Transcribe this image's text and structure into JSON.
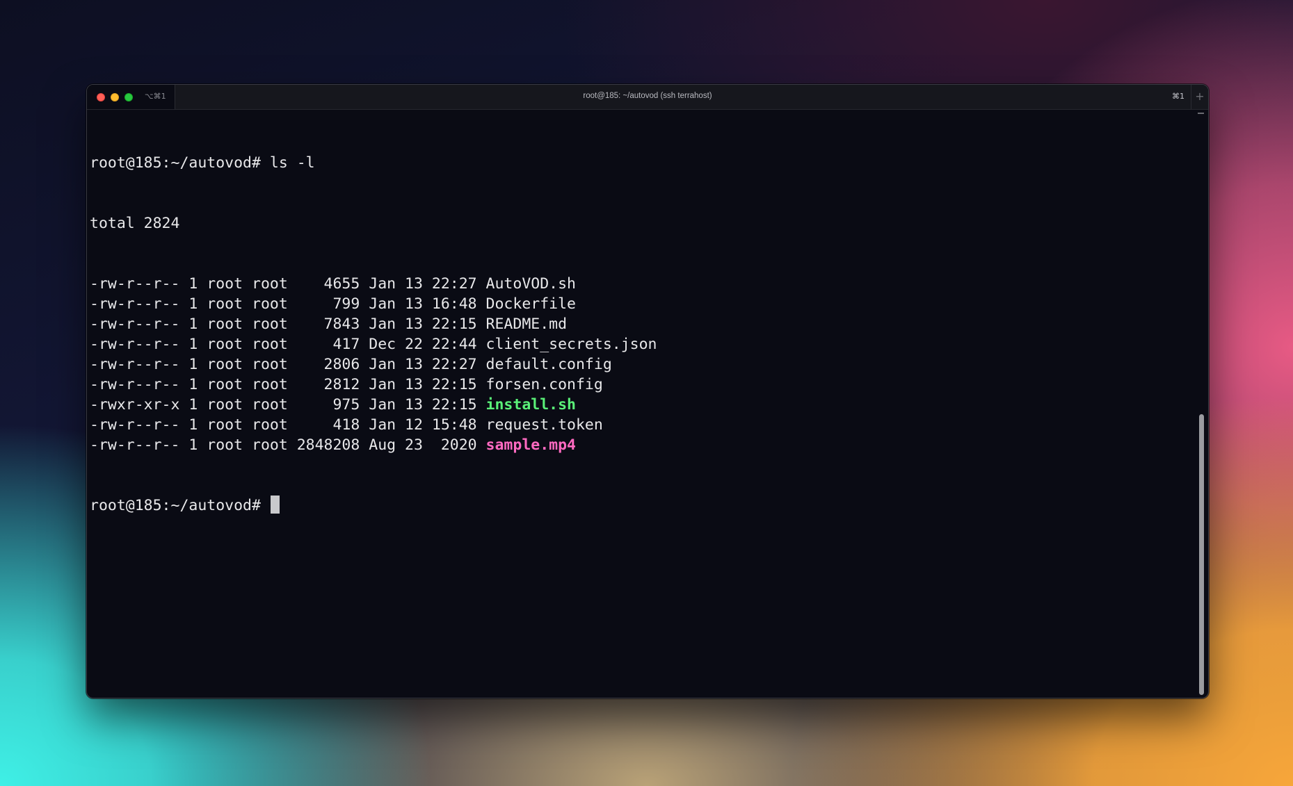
{
  "window": {
    "title": "root@185: ~/autovod (ssh terrahost)",
    "tab_shortcut": "⌥⌘1",
    "right_shortcut": "⌘1",
    "new_tab_label": "+"
  },
  "terminal": {
    "command_line": "root@185:~/autovod# ls -l",
    "total_line": "total 2824",
    "listing": [
      {
        "prefix": "-rw-r--r-- 1 root root    4655 Jan 13 22:27 ",
        "name": "AutoVOD.sh",
        "kind": "file"
      },
      {
        "prefix": "-rw-r--r-- 1 root root     799 Jan 13 16:48 ",
        "name": "Dockerfile",
        "kind": "file"
      },
      {
        "prefix": "-rw-r--r-- 1 root root    7843 Jan 13 22:15 ",
        "name": "README.md",
        "kind": "file"
      },
      {
        "prefix": "-rw-r--r-- 1 root root     417 Dec 22 22:44 ",
        "name": "client_secrets.json",
        "kind": "file"
      },
      {
        "prefix": "-rw-r--r-- 1 root root    2806 Jan 13 22:27 ",
        "name": "default.config",
        "kind": "file"
      },
      {
        "prefix": "-rw-r--r-- 1 root root    2812 Jan 13 22:15 ",
        "name": "forsen.config",
        "kind": "file"
      },
      {
        "prefix": "-rwxr-xr-x 1 root root     975 Jan 13 22:15 ",
        "name": "install.sh",
        "kind": "executable"
      },
      {
        "prefix": "-rw-r--r-- 1 root root     418 Jan 12 15:48 ",
        "name": "request.token",
        "kind": "file"
      },
      {
        "prefix": "-rw-r--r-- 1 root root 2848208 Aug 23  2020 ",
        "name": "sample.mp4",
        "kind": "media"
      }
    ],
    "prompt": "root@185:~/autovod# "
  },
  "colors": {
    "executable": "#5af078",
    "media": "#ff6ac1",
    "text": "#e8e8ea",
    "background": "#0a0b14"
  }
}
